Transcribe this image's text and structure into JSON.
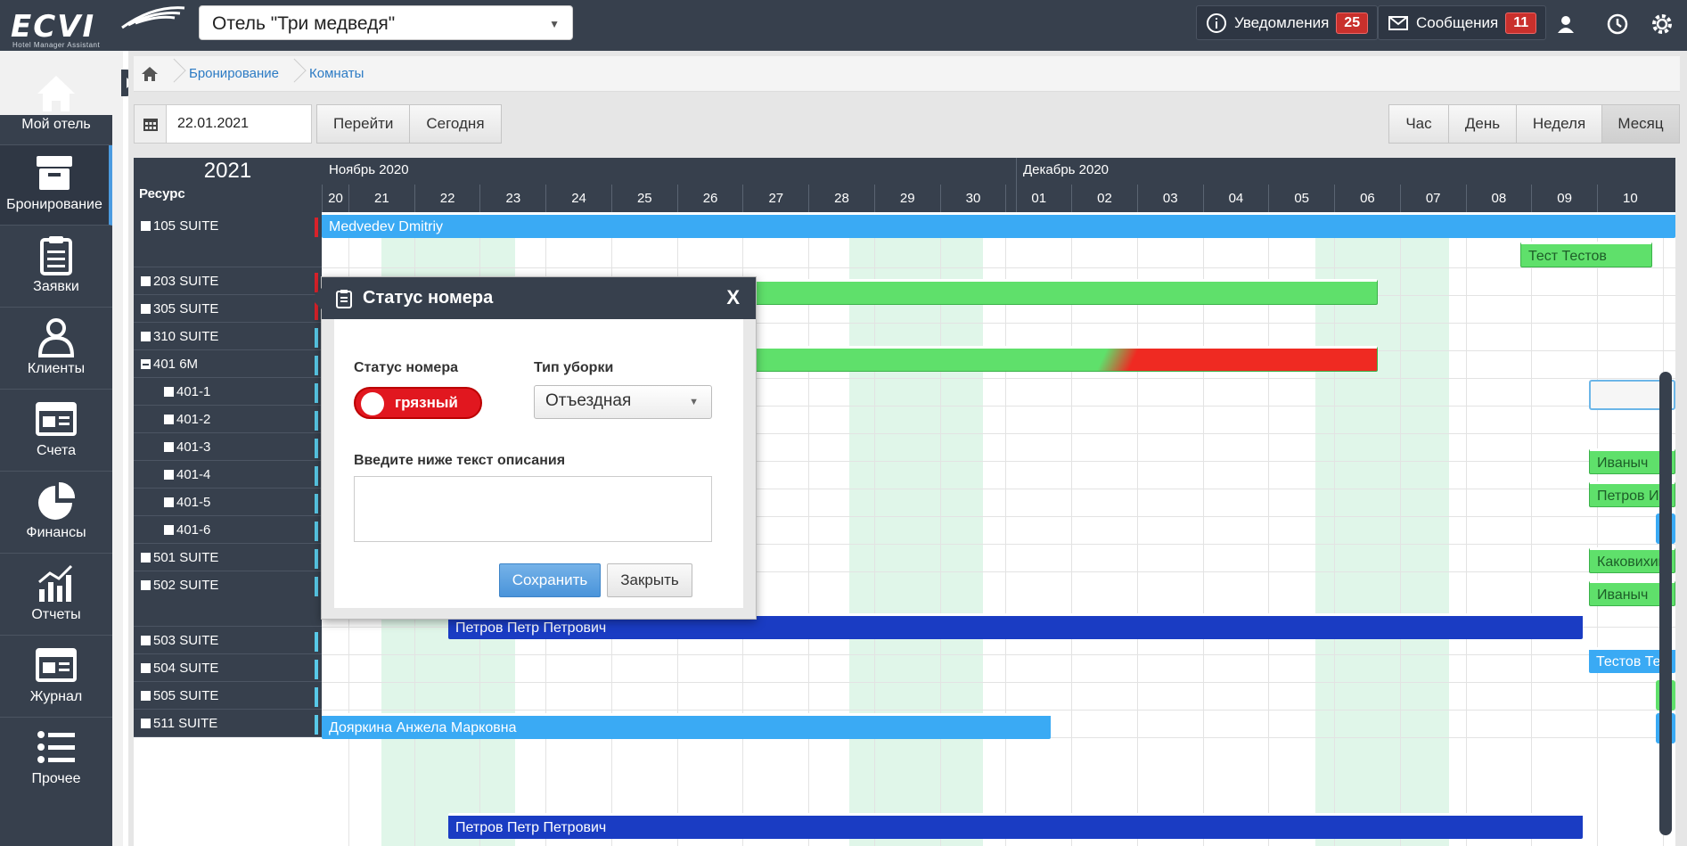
{
  "app": {
    "logo_text": "ECVI",
    "logo_subtitle": "Hotel Manager Assistant",
    "hotel_select": "Отель \"Три медведя\""
  },
  "topbar": {
    "notifications_label": "Уведомления",
    "notifications_count": "25",
    "messages_label": "Сообщения",
    "messages_count": "11",
    "icons": [
      "info-icon",
      "envelope-icon",
      "user-icon",
      "history-icon",
      "gear-icon"
    ]
  },
  "sidebar": {
    "items": [
      {
        "label": "Мой отель",
        "icon": "home-icon"
      },
      {
        "label": "Бронирование",
        "icon": "archive-box-icon",
        "active": true
      },
      {
        "label": "Заявки",
        "icon": "clipboard-icon"
      },
      {
        "label": "Клиенты",
        "icon": "person-icon"
      },
      {
        "label": "Счета",
        "icon": "invoice-icon"
      },
      {
        "label": "Финансы",
        "icon": "pie-chart-icon"
      },
      {
        "label": "Отчеты",
        "icon": "bar-chart-icon"
      },
      {
        "label": "Журнал",
        "icon": "journal-icon"
      },
      {
        "label": "Прочее",
        "icon": "list-icon"
      }
    ]
  },
  "breadcrumb": {
    "items": [
      "Бронирование",
      "Комнаты"
    ]
  },
  "toolbar": {
    "date_value": "22.01.2021",
    "go_label": "Перейти",
    "today_label": "Сегодня",
    "views": [
      "Час",
      "День",
      "Неделя",
      "Месяц"
    ],
    "active_view": "Месяц"
  },
  "calendar": {
    "year": "2021",
    "resource_header": "Ресурс",
    "months": [
      {
        "label": "Ноябрь 2020"
      },
      {
        "label": "Декабрь 2020"
      }
    ],
    "days": [
      "20",
      "21",
      "22",
      "23",
      "24",
      "25",
      "26",
      "27",
      "28",
      "29",
      "30",
      "01",
      "02",
      "03",
      "04",
      "05",
      "06",
      "07",
      "08",
      "09",
      "10"
    ],
    "resources": [
      {
        "label": "105 SUITE",
        "mark": "red"
      },
      {
        "label": "203 SUITE",
        "mark": "red"
      },
      {
        "label": "305 SUITE",
        "mark": "red"
      },
      {
        "label": "310 SUITE",
        "mark": "blue"
      },
      {
        "label": "401 6M",
        "mark": "blue",
        "expanded": true
      },
      {
        "label": "401-1",
        "mark": "blue"
      },
      {
        "label": "401-2",
        "mark": "blue"
      },
      {
        "label": "401-3",
        "mark": "blue"
      },
      {
        "label": "401-4",
        "mark": "blue"
      },
      {
        "label": "401-5",
        "mark": "blue"
      },
      {
        "label": "401-6",
        "mark": "blue"
      },
      {
        "label": "501 SUITE",
        "mark": "blue"
      },
      {
        "label": "502 SUITE",
        "mark": "blue"
      },
      {
        "label": "503 SUITE",
        "mark": "blue"
      },
      {
        "label": "504 SUITE",
        "mark": "blue"
      },
      {
        "label": "505 SUITE",
        "mark": "blue"
      },
      {
        "label": "511 SUITE",
        "mark": "blue"
      }
    ],
    "bookings": [
      {
        "guest": "Medvedev Dmitriy",
        "color": "#3aaaf4"
      },
      {
        "guest": "Тест Тестов",
        "color": "#5fe06b"
      },
      {
        "guest": "Иваныч",
        "color": "#5fe06b"
      },
      {
        "guest": "Петров Ив",
        "color": "#5fe06b"
      },
      {
        "guest": "Каковихин",
        "color": "#5fe06b"
      },
      {
        "guest": "Иваныч",
        "color": "#5fe06b"
      },
      {
        "guest": "Петров Петр Петрович",
        "color": "#1a3cc3"
      },
      {
        "guest": "Тестов Тес",
        "color": "#3aaaf4"
      },
      {
        "guest": "Дояркина Анжела Марковна",
        "color": "#3aaaf4"
      },
      {
        "guest": "Петров Петр Петрович",
        "color": "#1a3cc3"
      }
    ]
  },
  "modal": {
    "title": "Статус номера",
    "close_label": "X",
    "status_label": "Статус номера",
    "status_value": "грязный",
    "cleaning_label": "Тип уборки",
    "cleaning_value": "Отъездная",
    "description_label": "Введите ниже текст описания",
    "description_value": "",
    "save_label": "Сохранить",
    "cancel_label": "Закрыть"
  },
  "colors": {
    "topbar": "#37404d",
    "accent": "#4b9be0",
    "status_dirty": "#e1171f",
    "booking_light": "#3aaaf4",
    "booking_dark": "#1a3cc3",
    "booking_green": "#5fe06b"
  }
}
